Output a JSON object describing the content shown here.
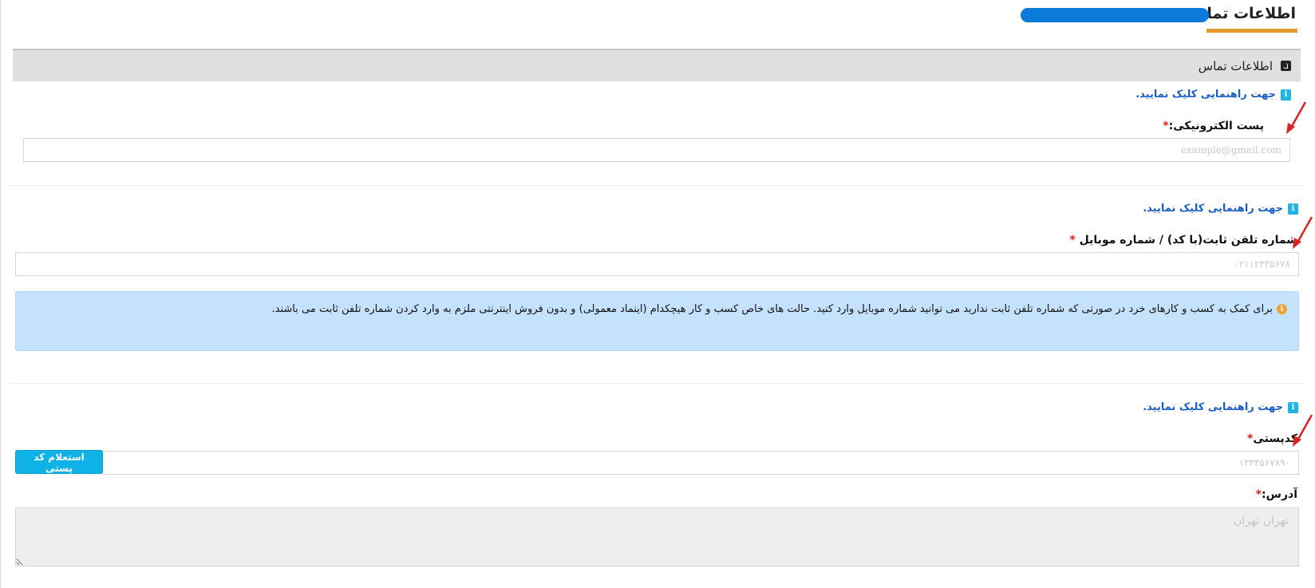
{
  "page": {
    "title": "اطلاعات تماس"
  },
  "section": {
    "title": "اطلاعات تماس",
    "icon": "phone-icon"
  },
  "help": {
    "label": "جهت راهنمایی کلیک نمایید.",
    "icon": "info-icon"
  },
  "email": {
    "label": "پست الکترونیکی:",
    "required_mark": "*",
    "placeholder": "example@gmail.com"
  },
  "phone": {
    "label": "شماره تلفن ثابت(با کد) / شماره موبایل ",
    "required_mark": "*",
    "placeholder": "۰۲۱۱۲۳۴۵۶۷۸"
  },
  "alert": {
    "icon": "info-circle-icon",
    "text": "برای کمک به کسب و کارهای خرد در صورتی که شماره تلفن ثابت ندارید می توانید شماره موبایل وارد کنید. حالت های خاص کسب و کار هیچکدام (اینماد معمولی) و بدون فروش اینترنتی ملزم به وارد کردن شماره تلفن ثابت می باشند."
  },
  "postal": {
    "label": "کدپستی",
    "required_mark": "*",
    "placeholder": "۱۲۳۴۵۶۷۸۹۰",
    "button_label": "استعلام کد پستی"
  },
  "address": {
    "label": "آدرس:",
    "required_mark": "*",
    "placeholder": "تهران تهران"
  },
  "colors": {
    "accent_underline": "#e59b2c",
    "link": "#1a5ec7",
    "help_icon": "#1fb5e3",
    "button": "#0fb2e6",
    "alert_bg": "#c4e2fb",
    "required": "#e02020",
    "annotation_arrow": "#e02020"
  }
}
